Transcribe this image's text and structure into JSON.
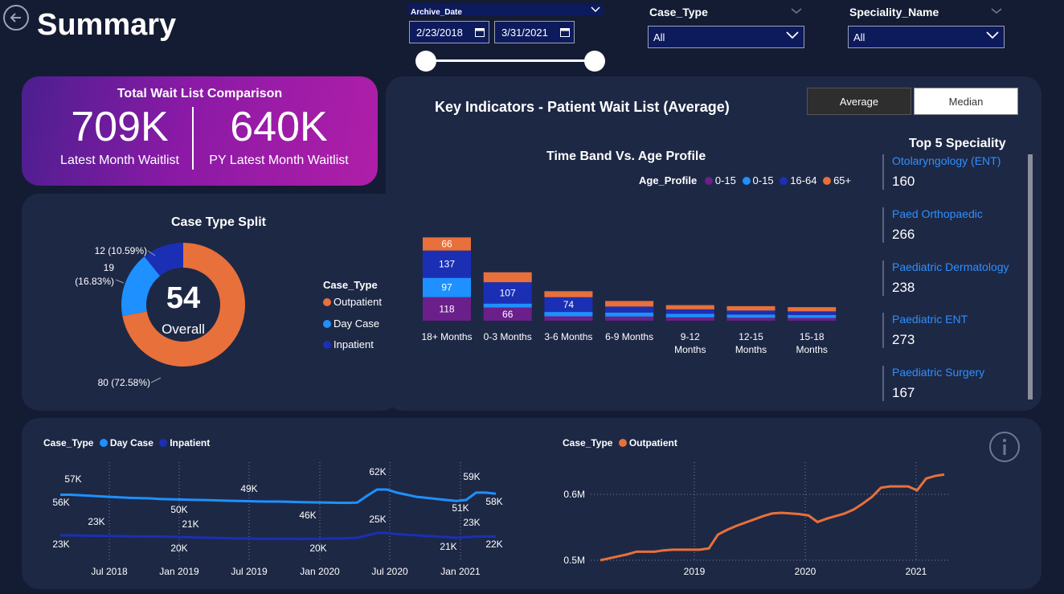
{
  "header": {
    "title": "Summary"
  },
  "filters": {
    "archive_date_label": "Archive_Date",
    "date_from": "2/23/2018",
    "date_to": "3/31/2021",
    "case_type_label": "Case_Type",
    "case_type_value": "All",
    "speciality_label": "Speciality_Name",
    "speciality_value": "All"
  },
  "kpi": {
    "title": "Total Wait List Comparison",
    "latest_value": "709K",
    "latest_label": "Latest Month Waitlist",
    "py_value": "640K",
    "py_label": "PY Latest Month Waitlist"
  },
  "key_indicators": {
    "title": "Key Indicators - Patient Wait List (Average)",
    "toggle_average": "Average",
    "toggle_median": "Median"
  },
  "top5": {
    "title": "Top 5 Speciality",
    "items": [
      {
        "name": "Otolaryngology (ENT)",
        "value": "160"
      },
      {
        "name": "Paed Orthopaedic",
        "value": "266"
      },
      {
        "name": "Paediatric Dermatology",
        "value": "238"
      },
      {
        "name": "Paediatric ENT",
        "value": "273"
      },
      {
        "name": "Paediatric Surgery",
        "value": "167"
      }
    ]
  },
  "colors": {
    "outpatient": "#e8703a",
    "day_case": "#1e90ff",
    "inpatient": "#1b2fb5",
    "age_purple": "#6b1f8a",
    "panel": "#1d2845",
    "background": "#141c33"
  },
  "chart_data": [
    {
      "type": "pie",
      "title": "Case Type Split",
      "center_value": "54",
      "center_label": "Overall",
      "legend_title": "Case_Type",
      "slices": [
        {
          "name": "Outpatient",
          "value": 80,
          "label": "80 (72.58%)",
          "color": "#e8703a"
        },
        {
          "name": "Day Case",
          "value": 19,
          "label_line1": "19",
          "label_line2": "(16.83%)",
          "color": "#1e90ff"
        },
        {
          "name": "Inpatient",
          "value": 12,
          "label": "12 (10.59%)",
          "color": "#1b2fb5"
        }
      ]
    },
    {
      "type": "bar",
      "title": "Time Band Vs. Age Profile",
      "legend_title": "Age_Profile",
      "legend": [
        {
          "name": "0-15",
          "color": "#6b1f8a"
        },
        {
          "name": "0-15",
          "color": "#1e90ff"
        },
        {
          "name": "16-64",
          "color": "#1b2fb5"
        },
        {
          "name": "65+",
          "color": "#e8703a"
        }
      ],
      "categories": [
        {
          "line1": "18+ Months",
          "line2": ""
        },
        {
          "line1": "0-3 Months",
          "line2": ""
        },
        {
          "line1": "3-6 Months",
          "line2": ""
        },
        {
          "line1": "6-9 Months",
          "line2": ""
        },
        {
          "line1": "9-12",
          "line2": "Months"
        },
        {
          "line1": "12-15",
          "line2": "Months"
        },
        {
          "line1": "15-18",
          "line2": "Months"
        }
      ],
      "series": [
        {
          "name": "0-15",
          "color": "#6b1f8a",
          "values": [
            118,
            66,
            22,
            21,
            17,
            15,
            14
          ],
          "labels": [
            "118",
            "66",
            "",
            "",
            "",
            "",
            ""
          ]
        },
        {
          "name": "0-15",
          "color": "#1e90ff",
          "values": [
            97,
            20,
            22,
            20,
            18,
            16,
            15
          ],
          "labels": [
            "97",
            "",
            "",
            "",
            "",
            "",
            ""
          ]
        },
        {
          "name": "16-64",
          "color": "#1b2fb5",
          "values": [
            137,
            107,
            74,
            30,
            22,
            20,
            18
          ],
          "labels": [
            "137",
            "107",
            "74",
            "",
            "",
            "",
            ""
          ]
        },
        {
          "name": "65+",
          "color": "#e8703a",
          "values": [
            66,
            50,
            30,
            28,
            21,
            22,
            21
          ],
          "labels": [
            "66",
            "",
            "",
            "",
            "",
            "",
            ""
          ]
        }
      ]
    },
    {
      "type": "line",
      "legend_title": "Case_Type",
      "series": [
        {
          "name": "Day Case",
          "color": "#1e90ff"
        },
        {
          "name": "Inpatient",
          "color": "#1b2fb5"
        }
      ],
      "x_ticks": [
        "Jul 2018",
        "Jan 2019",
        "Jul 2019",
        "Jan 2020",
        "Jul 2020",
        "Jan 2021"
      ],
      "day_case_values": [
        57,
        57,
        56.5,
        56,
        55.5,
        55,
        54.5,
        54,
        53.7,
        53.5,
        53,
        52.7,
        52.5,
        52.2,
        52,
        51.8,
        51.5,
        51.2,
        51,
        50.8,
        50.6,
        50.5,
        50.5,
        50.3,
        50,
        49.8,
        49.6,
        49.5,
        49.3,
        49.2,
        49.5,
        56,
        62,
        62,
        59,
        57,
        55,
        54,
        53,
        52,
        51,
        52,
        59,
        59,
        58
      ],
      "inpatient_values": [
        23,
        23,
        22.8,
        22.7,
        22.6,
        22.5,
        22.3,
        22.2,
        22.1,
        22,
        22,
        21.8,
        21.6,
        21.4,
        21.2,
        21,
        20.8,
        20.6,
        20.4,
        20.3,
        20.2,
        20.2,
        20.1,
        20.1,
        20,
        20.1,
        20.2,
        20.3,
        20.4,
        20.6,
        21,
        23,
        25,
        25,
        24,
        23.5,
        23,
        22.5,
        22,
        21.5,
        21,
        21.5,
        22,
        22,
        22
      ],
      "labels": {
        "dc": [
          "57K",
          "56K",
          "50K",
          "49K",
          "46K",
          "62K",
          "51K",
          "59K",
          "58K"
        ],
        "ip": [
          "23K",
          "23K",
          "21K",
          "20K",
          "20K",
          "25K",
          "21K",
          "23K",
          "22K"
        ]
      }
    },
    {
      "type": "line",
      "legend_title": "Case_Type",
      "series": [
        {
          "name": "Outpatient",
          "color": "#e8703a"
        }
      ],
      "x_ticks": [
        "2019",
        "2020",
        "2021"
      ],
      "y_ticks": [
        "0.6M",
        "0.5M"
      ],
      "values_m": [
        0.5,
        0.503,
        0.506,
        0.509,
        0.513,
        0.513,
        0.513,
        0.515,
        0.516,
        0.516,
        0.516,
        0.516,
        0.518,
        0.539,
        0.546,
        0.552,
        0.557,
        0.562,
        0.567,
        0.571,
        0.572,
        0.571,
        0.57,
        0.568,
        0.558,
        0.563,
        0.567,
        0.571,
        0.577,
        0.586,
        0.596,
        0.61,
        0.612,
        0.612,
        0.612,
        0.606,
        0.624,
        0.628,
        0.63
      ]
    }
  ]
}
